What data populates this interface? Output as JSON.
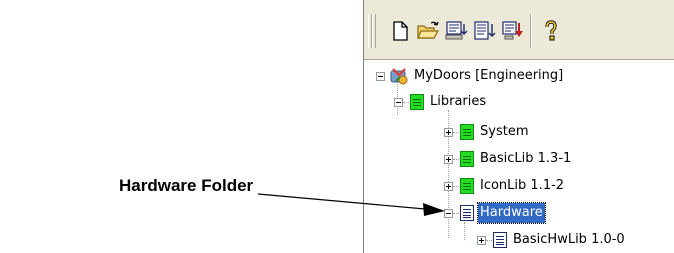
{
  "callout": {
    "label": "Hardware Folder"
  },
  "toolbar": {
    "buttons": [
      {
        "icon": "new-document-icon"
      },
      {
        "icon": "open-folder-icon"
      },
      {
        "icon": "import-icon"
      },
      {
        "icon": "export-icon"
      },
      {
        "icon": "download-icon"
      },
      {
        "icon": "help-icon"
      }
    ]
  },
  "tree": {
    "root": {
      "label": "MyDoors [Engineering]",
      "icon": "database-icon"
    },
    "libraries": {
      "label": "Libraries",
      "icon": "green-folder-icon"
    },
    "items": [
      {
        "label": "System",
        "icon": "green-folder-icon"
      },
      {
        "label": "BasicLib 1.3-1",
        "icon": "green-folder-icon"
      },
      {
        "label": "IconLib 1.1-2",
        "icon": "green-folder-icon"
      }
    ],
    "hardware": {
      "label": "Hardware",
      "icon": "document-folder-icon",
      "selected": true
    },
    "hardware_child": {
      "label": "BasicHwLib 1.0-0",
      "icon": "document-folder-icon"
    }
  },
  "colors": {
    "selection": "#316ac5",
    "green_folder": "#22dd22",
    "toolbar_bg": "#ece9d8"
  }
}
